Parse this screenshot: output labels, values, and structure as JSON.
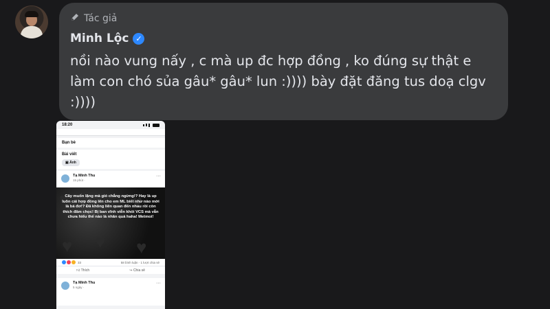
{
  "author_label": "Tác giả",
  "author_name": "Minh Lộc",
  "message": "nồi nào vung nấy , c mà up đc hợp đồng , ko đúng sự thật e làm con chó sủa gâu* gâu* lun :)))) bày đặt đăng tus doạ clgv :))))",
  "icons": {
    "author_badge": "pen-icon",
    "verified": "verified-badge-icon"
  },
  "colors": {
    "bubble": "#3a3b3d",
    "background": "#19191b",
    "verified": "#2d88ff"
  },
  "screenshot": {
    "status_time": "18:20",
    "friends_label": "Bạn bè",
    "posts_label": "Bài viết",
    "photo_chip": "Ảnh",
    "post": {
      "author": "Tạ Minh Thu",
      "time": "15 phút ·",
      "image_text": "Cây muốn lặng mà gió chẳng ngừng!? Hay là up luôn cái hợp đồng lên cho em ML biết như nào mới là bá đơ!? Đã không liên quan đến nhau rồi còn thích đâm chọc! Bị ban vĩnh viễn khỏi VCS mà vẫn chưa hiểu thế nào là nhân quả haha! Metmoi!",
      "reaction_count": "33",
      "comment_share": "58 bình luận · 1 lượt chia sẻ",
      "like_label": "Thích",
      "share_label": "Chia sẻ"
    },
    "post2": {
      "author": "Tạ Minh Thu",
      "time": "5 ngày ·"
    }
  }
}
